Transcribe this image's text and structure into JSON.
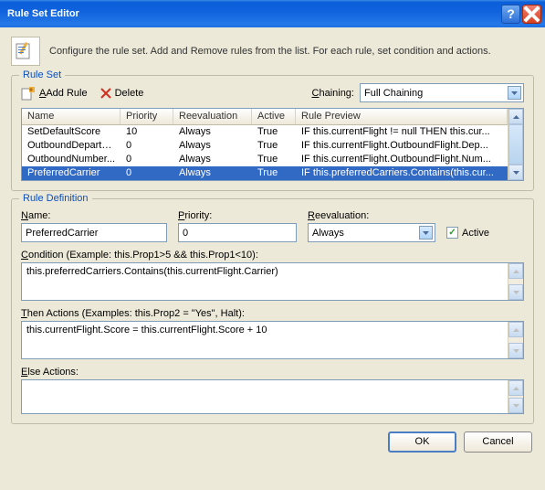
{
  "window": {
    "title": "Rule Set Editor"
  },
  "intro": "Configure the rule set. Add and Remove rules from the list. For each rule, set condition and actions.",
  "ruleset": {
    "legend": "Rule Set",
    "add_label": "Add Rule",
    "delete_label": "Delete",
    "chaining_label": "Chaining:",
    "chaining_value": "Full Chaining",
    "columns": {
      "name": "Name",
      "priority": "Priority",
      "reeval": "Reevaluation",
      "active": "Active",
      "preview": "Rule Preview"
    },
    "rows": [
      {
        "name": "SetDefaultScore",
        "priority": "10",
        "reeval": "Always",
        "active": "True",
        "preview": "IF this.currentFlight != null THEN this.cur..."
      },
      {
        "name": "OutboundDepartu...",
        "priority": "0",
        "reeval": "Always",
        "active": "True",
        "preview": "IF this.currentFlight.OutboundFlight.Dep..."
      },
      {
        "name": "OutboundNumber...",
        "priority": "0",
        "reeval": "Always",
        "active": "True",
        "preview": "IF this.currentFlight.OutboundFlight.Num..."
      },
      {
        "name": "PreferredCarrier",
        "priority": "0",
        "reeval": "Always",
        "active": "True",
        "preview": "IF this.preferredCarriers.Contains(this.cur..."
      }
    ]
  },
  "def": {
    "legend": "Rule Definition",
    "name_label": "Name:",
    "name_value": "PreferredCarrier",
    "priority_label": "Priority:",
    "priority_value": "0",
    "reeval_label": "Reevaluation:",
    "reeval_value": "Always",
    "active_label": "Active",
    "condition_label": "Condition (Example:  this.Prop1>5 && this.Prop1<10):",
    "condition_value": "this.preferredCarriers.Contains(this.currentFlight.Carrier)",
    "then_label": "Then Actions (Examples: this.Prop2 = \"Yes\", Halt):",
    "then_value": "this.currentFlight.Score = this.currentFlight.Score + 10",
    "else_label": "Else Actions:",
    "else_value": ""
  },
  "buttons": {
    "ok": "OK",
    "cancel": "Cancel"
  }
}
